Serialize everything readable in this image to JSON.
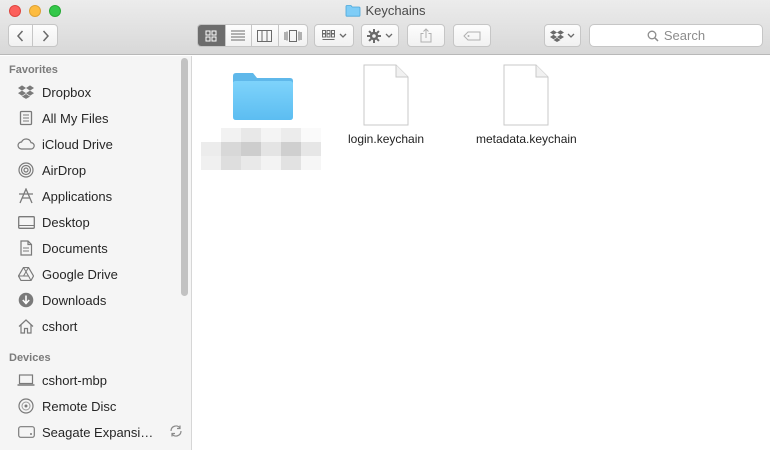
{
  "window": {
    "title": "Keychains",
    "title_icon": "folder-icon"
  },
  "toolbar": {
    "back_icon": "chevron-left-icon",
    "forward_icon": "chevron-right-icon",
    "view_modes": [
      "icon-view",
      "list-view",
      "column-view",
      "cover-flow-view"
    ],
    "active_view": "icon-view",
    "arrange_icon": "arrange-grid-icon",
    "action_icon": "gear-icon",
    "share_icon": "share-icon",
    "tag_icon": "tag-icon",
    "dropbox_icon": "dropbox-icon",
    "search_placeholder": "Search"
  },
  "sidebar": {
    "favorites_heading": "Favorites",
    "favorites": [
      {
        "label": "Dropbox",
        "icon": "dropbox-icon"
      },
      {
        "label": "All My Files",
        "icon": "all-files-icon"
      },
      {
        "label": "iCloud Drive",
        "icon": "cloud-icon"
      },
      {
        "label": "AirDrop",
        "icon": "airdrop-icon"
      },
      {
        "label": "Applications",
        "icon": "applications-icon"
      },
      {
        "label": "Desktop",
        "icon": "desktop-icon"
      },
      {
        "label": "Documents",
        "icon": "documents-icon"
      },
      {
        "label": "Google Drive",
        "icon": "google-drive-icon"
      },
      {
        "label": "Downloads",
        "icon": "downloads-icon"
      },
      {
        "label": "cshort",
        "icon": "home-icon"
      }
    ],
    "devices_heading": "Devices",
    "devices": [
      {
        "label": "cshort-mbp",
        "icon": "laptop-icon"
      },
      {
        "label": "Remote Disc",
        "icon": "disc-icon"
      },
      {
        "label": "Seagate Expansi…",
        "icon": "drive-icon"
      }
    ]
  },
  "content": {
    "items": [
      {
        "name": "",
        "kind": "folder",
        "icon": "folder-icon",
        "name_obscured": true
      },
      {
        "name": "login.keychain",
        "kind": "file",
        "icon": "document-icon"
      },
      {
        "name": "metadata.keychain",
        "kind": "file",
        "icon": "document-icon"
      }
    ]
  },
  "colors": {
    "folder_blue": "#68c6f6",
    "active_segment": "#6d6d6d",
    "sidebar_bg": "#f5f5f5"
  }
}
